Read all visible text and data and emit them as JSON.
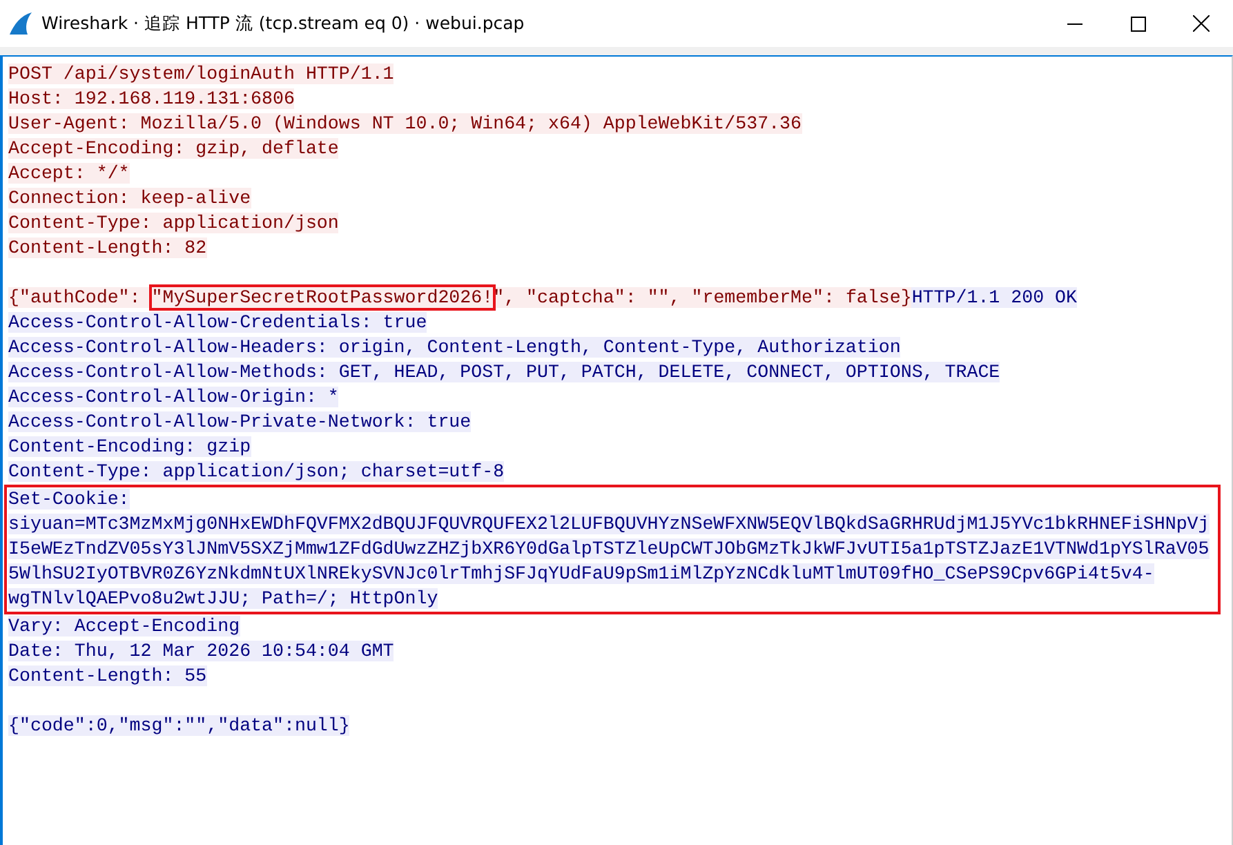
{
  "window": {
    "title": "Wireshark · 追踪 HTTP 流 (tcp.stream eq 0) · webui.pcap"
  },
  "paragraphs": [
    {
      "groups": [
        {
          "flagged": false,
          "lines": [
            {
              "segments": [
                {
                  "text": "POST /api/system/loginAuth HTTP/1.1",
                  "kind": "client",
                  "flagged": false
                }
              ]
            },
            {
              "segments": [
                {
                  "text": "Host: 192.168.119.131:6806",
                  "kind": "client",
                  "flagged": false
                }
              ]
            },
            {
              "segments": [
                {
                  "text": "User-Agent: Mozilla/5.0 (Windows NT 10.0; Win64; x64) AppleWebKit/537.36",
                  "kind": "client",
                  "flagged": false
                }
              ]
            },
            {
              "segments": [
                {
                  "text": "Accept-Encoding: gzip, deflate",
                  "kind": "client",
                  "flagged": false
                }
              ]
            },
            {
              "segments": [
                {
                  "text": "Accept: */*",
                  "kind": "client",
                  "flagged": false
                }
              ]
            },
            {
              "segments": [
                {
                  "text": "Connection: keep-alive",
                  "kind": "client",
                  "flagged": false
                }
              ]
            },
            {
              "segments": [
                {
                  "text": "Content-Type: application/json",
                  "kind": "client",
                  "flagged": false
                }
              ]
            },
            {
              "segments": [
                {
                  "text": "Content-Length: 82",
                  "kind": "client",
                  "flagged": false
                }
              ]
            }
          ]
        }
      ]
    },
    {
      "groups": [
        {
          "flagged": false,
          "lines": [
            {
              "segments": [
                {
                  "text": "{\"authCode\": ",
                  "kind": "client",
                  "flagged": false
                },
                {
                  "text": "\"MySuperSecretRootPassword2026!",
                  "kind": "client",
                  "flagged": true
                },
                {
                  "text": "\", \"captcha\": \"\", \"rememberMe\": false}",
                  "kind": "client",
                  "flagged": false
                },
                {
                  "text": "HTTP/1.1 200 OK",
                  "kind": "server",
                  "flagged": false
                }
              ]
            },
            {
              "segments": [
                {
                  "text": "Access-Control-Allow-Credentials: true",
                  "kind": "server",
                  "flagged": false
                }
              ]
            },
            {
              "segments": [
                {
                  "text": "Access-Control-Allow-Headers: origin, Content-Length, Content-Type, Authorization",
                  "kind": "server",
                  "flagged": false
                }
              ]
            },
            {
              "segments": [
                {
                  "text": "Access-Control-Allow-Methods: GET, HEAD, POST, PUT, PATCH, DELETE, CONNECT, OPTIONS, TRACE",
                  "kind": "server",
                  "flagged": false
                }
              ]
            },
            {
              "segments": [
                {
                  "text": "Access-Control-Allow-Origin: *",
                  "kind": "server",
                  "flagged": false
                }
              ]
            },
            {
              "segments": [
                {
                  "text": "Access-Control-Allow-Private-Network: true",
                  "kind": "server",
                  "flagged": false
                }
              ]
            },
            {
              "segments": [
                {
                  "text": "Content-Encoding: gzip",
                  "kind": "server",
                  "flagged": false
                }
              ]
            },
            {
              "segments": [
                {
                  "text": "Content-Type: application/json; charset=utf-8",
                  "kind": "server",
                  "flagged": false
                }
              ]
            }
          ]
        },
        {
          "flagged": true,
          "lines": [
            {
              "segments": [
                {
                  "text": "Set-Cookie:",
                  "kind": "server",
                  "flagged": false
                }
              ]
            },
            {
              "segments": [
                {
                  "text": "siyuan=MTc3MzMxMjg0NHxEWDhFQVFMX2dBQUJFQUVRQUFEX2l2LUFBQUVHYzNSeWFXNW5EQVlBQkdSaGRHRUdjM1J5YVc1bkRHNEFiSHNpVj",
                  "kind": "server",
                  "flagged": false
                }
              ]
            },
            {
              "segments": [
                {
                  "text": "I5eWEzTndZV05sY3lJNmV5SXZjMmw1ZFdGdUwzZHZjbXR6Y0dGalpTSTZleUpCWTJObGMzTkJkWFJvUTI5a1pTSTZJazE1VTNWd1pYSlRaV05",
                  "kind": "server",
                  "flagged": false
                }
              ]
            },
            {
              "segments": [
                {
                  "text": "5WlhSU2IyOTBVR0Z6YzNkdmNtUXlNREkySVNJc0lrTmhjSFJqYUdFaU9pSm1iMlZpYzNCdkluMTlmUT09fHO_CSePS9Cpv6GPi4t5v4-",
                  "kind": "server",
                  "flagged": false
                }
              ]
            },
            {
              "segments": [
                {
                  "text": "wgTNlvlQAEPvo8u2wtJJU; Path=/; HttpOnly",
                  "kind": "server",
                  "flagged": false
                }
              ]
            }
          ]
        },
        {
          "flagged": false,
          "lines": [
            {
              "segments": [
                {
                  "text": "Vary: Accept-Encoding",
                  "kind": "server",
                  "flagged": false
                }
              ]
            },
            {
              "segments": [
                {
                  "text": "Date: Thu, 12 Mar 2026 10:54:04 GMT",
                  "kind": "server",
                  "flagged": false
                }
              ]
            },
            {
              "segments": [
                {
                  "text": "Content-Length: 55",
                  "kind": "server",
                  "flagged": false
                }
              ]
            }
          ]
        }
      ]
    },
    {
      "groups": [
        {
          "flagged": false,
          "lines": [
            {
              "segments": [
                {
                  "text": "{\"code\":0,\"msg\":\"\",\"data\":null}",
                  "kind": "server",
                  "flagged": false
                }
              ]
            }
          ]
        }
      ]
    }
  ]
}
